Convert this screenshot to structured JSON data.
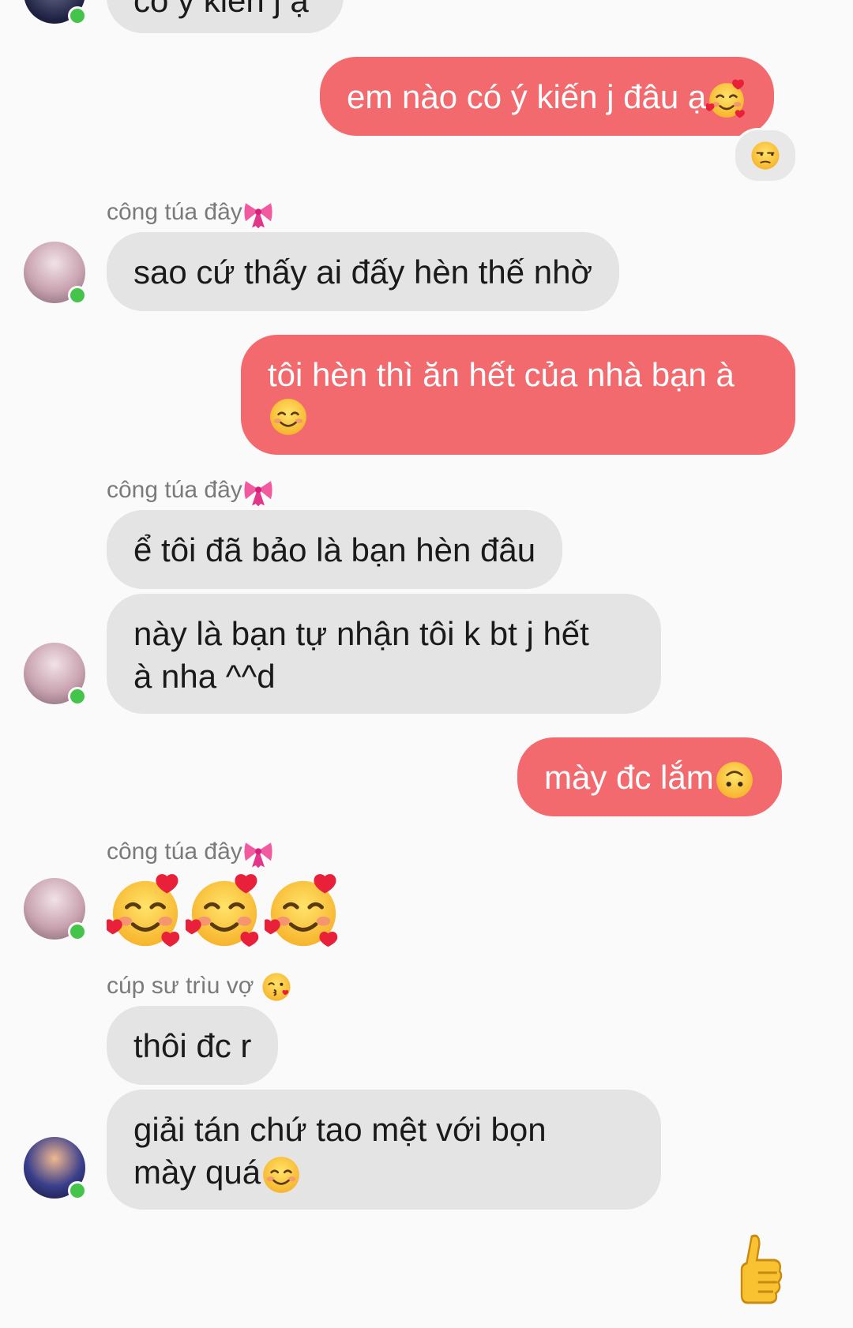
{
  "top_partial": {
    "text": "có ý kiến j ạ"
  },
  "messages": [
    {
      "id": "m1",
      "direction": "out",
      "text": "em nào có ý kiến j đâu ạ",
      "trailing_emoji": "smiling-face-with-hearts",
      "reaction_emoji": "unamused-face"
    },
    {
      "id": "m2",
      "direction": "in",
      "sender": "công túa đây",
      "sender_emoji": "ribbon",
      "text": "sao cứ thấy ai đấy hèn thế nhờ"
    },
    {
      "id": "m3",
      "direction": "out",
      "line1": "tôi hèn thì ăn hết của nhà bạn à",
      "trailing_emoji": "smiling-face-with-smiling-eyes"
    },
    {
      "id": "m4",
      "direction": "in",
      "sender": "công túa đây",
      "sender_emoji": "ribbon",
      "text": "ể tôi đã bảo là bạn hèn đâu"
    },
    {
      "id": "m5",
      "direction": "in",
      "line1": "này là bạn tự nhận tôi k bt j hết",
      "line2": "à nha ^^d"
    },
    {
      "id": "m6",
      "direction": "out",
      "text": "mày đc lắm",
      "trailing_emoji": "upside-down-face"
    },
    {
      "id": "m7",
      "direction": "in",
      "sender": "công túa đây",
      "sender_emoji": "ribbon",
      "emojis": [
        "smiling-face-with-hearts",
        "smiling-face-with-hearts",
        "smiling-face-with-hearts"
      ]
    },
    {
      "id": "m8",
      "direction": "in",
      "sender": "cúp sư trìu vợ",
      "sender_emoji": "face-blowing-kiss",
      "text": "thôi đc r"
    },
    {
      "id": "m9",
      "direction": "in",
      "line1": "giải tán chứ tao mệt với bọn",
      "line2": "mày quá",
      "trailing_emoji": "smiling-face-with-smiling-eyes"
    }
  ],
  "composer": {
    "like_icon": "thumbs-up"
  },
  "colors": {
    "outgoing_bubble": "#f26a6e",
    "incoming_bubble": "#e4e4e4",
    "online_dot": "#44c44a",
    "background": "#fafafa"
  }
}
